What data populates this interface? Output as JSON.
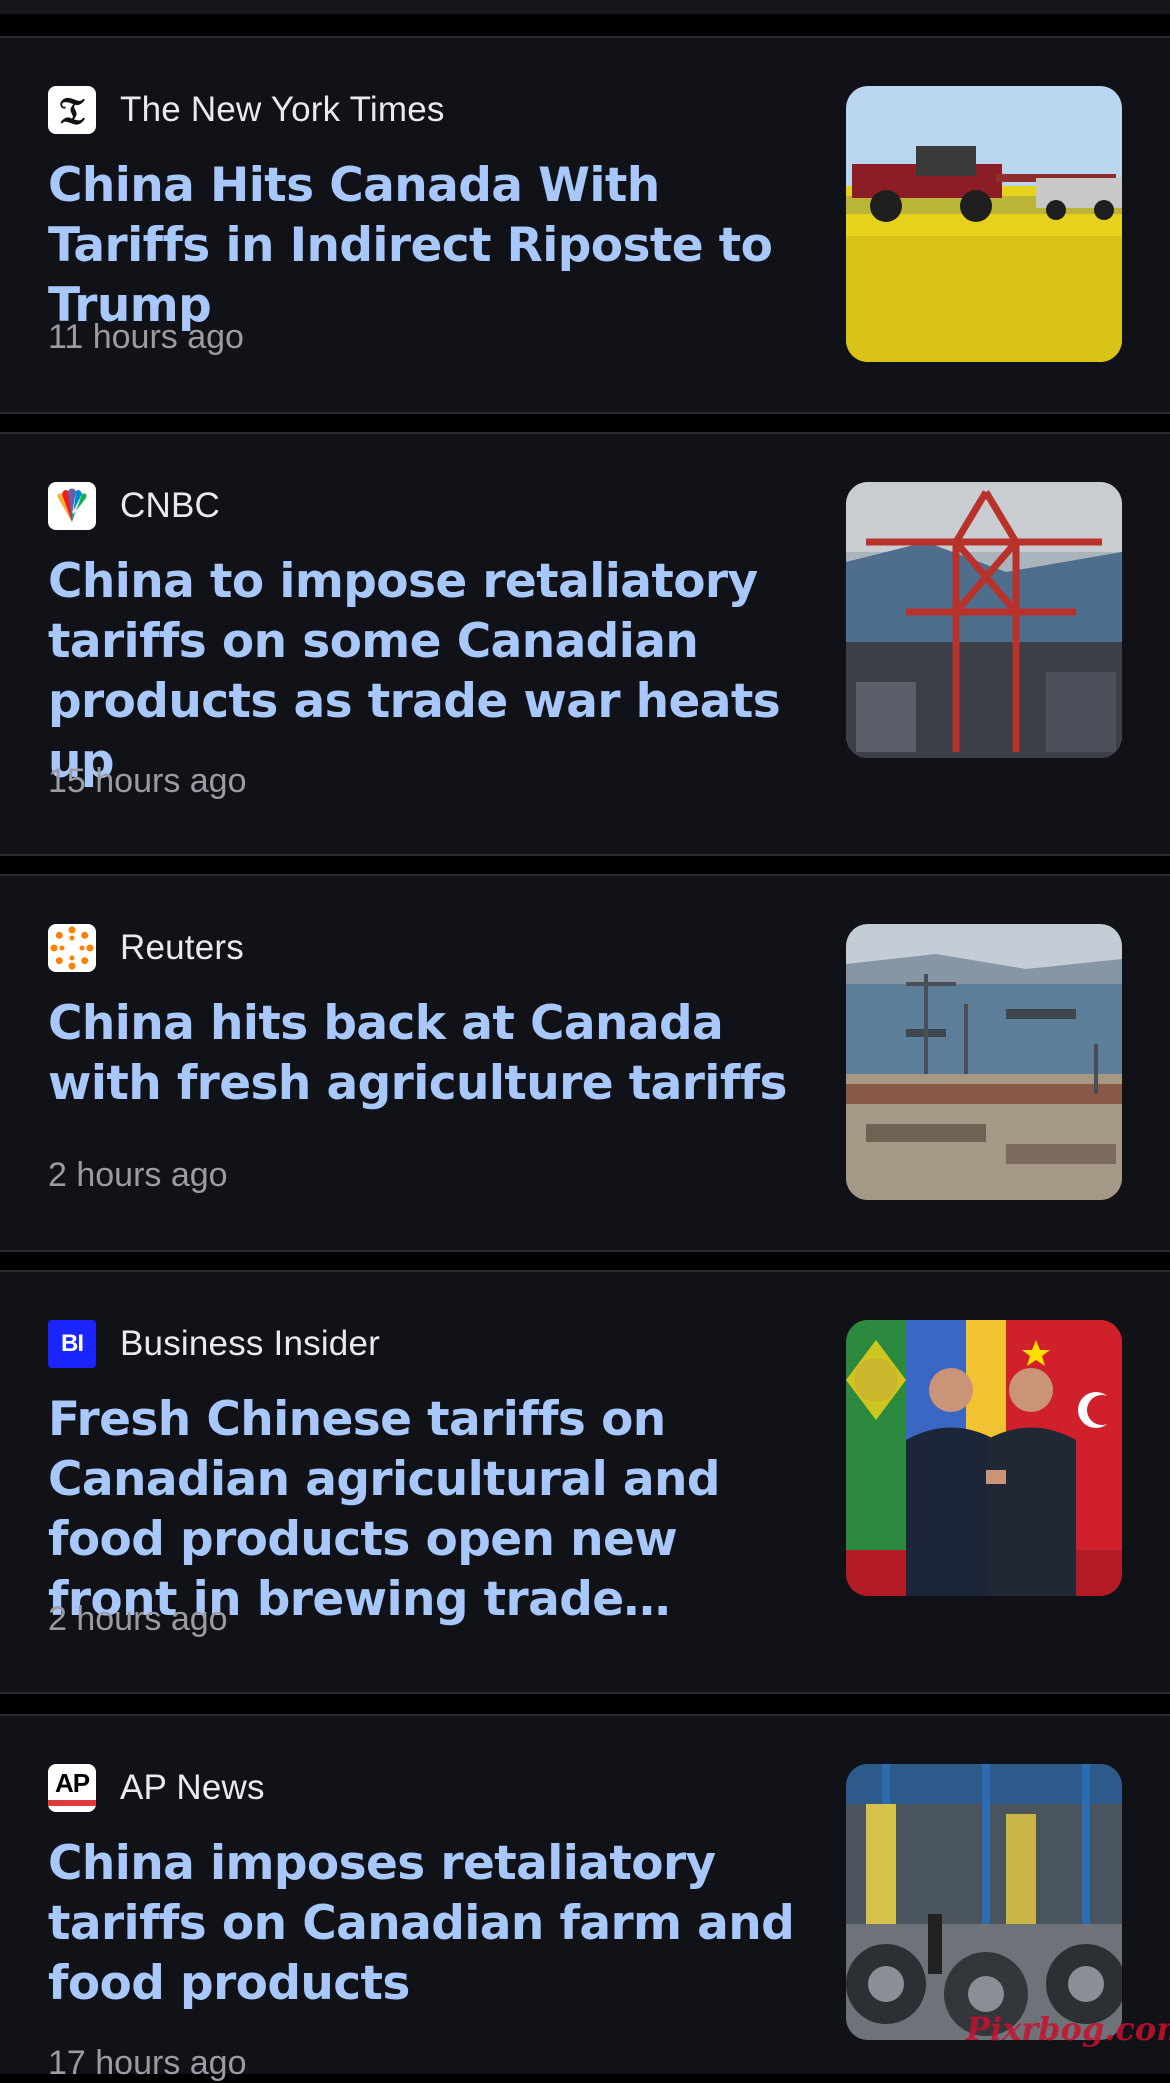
{
  "articles": [
    {
      "source": "The New York Times",
      "source_icon": "nyt-logo-icon",
      "headline": "China Hits Canada With Tariffs in Indirect Riposte to Trump",
      "time": "11 hours ago",
      "thumbnail": "canola-field-tractor-image"
    },
    {
      "source": "CNBC",
      "source_icon": "cnbc-peacock-logo-icon",
      "headline": "China to impose retaliatory tariffs on some Canadian products as trade war heats up",
      "time": "15 hours ago",
      "thumbnail": "port-crane-image"
    },
    {
      "source": "Reuters",
      "source_icon": "reuters-logo-icon",
      "headline": "China hits back at Canada with fresh agriculture tariffs",
      "time": "2 hours ago",
      "thumbnail": "harbor-aerial-image"
    },
    {
      "source": "Business Insider",
      "source_icon": "business-insider-logo-icon",
      "headline": "Fresh Chinese tariffs on Canadian agricultural and food products open new front in brewing trade…",
      "time": "2 hours ago",
      "thumbnail": "leaders-handshake-image"
    },
    {
      "source": "AP News",
      "source_icon": "ap-logo-icon",
      "headline": "China imposes retaliatory tariffs on Canadian farm and food products",
      "time": "17 hours ago",
      "thumbnail": "steel-coils-factory-image"
    }
  ],
  "logos": {
    "business_insider_text": "BI",
    "ap_text": "AP"
  },
  "watermark": "Pixrbog.com",
  "colors": {
    "headline": "#a8c7fa",
    "source": "#e9eaee",
    "time": "#9a9ca3",
    "card_bg": "#111217",
    "page_bg": "#000000"
  }
}
